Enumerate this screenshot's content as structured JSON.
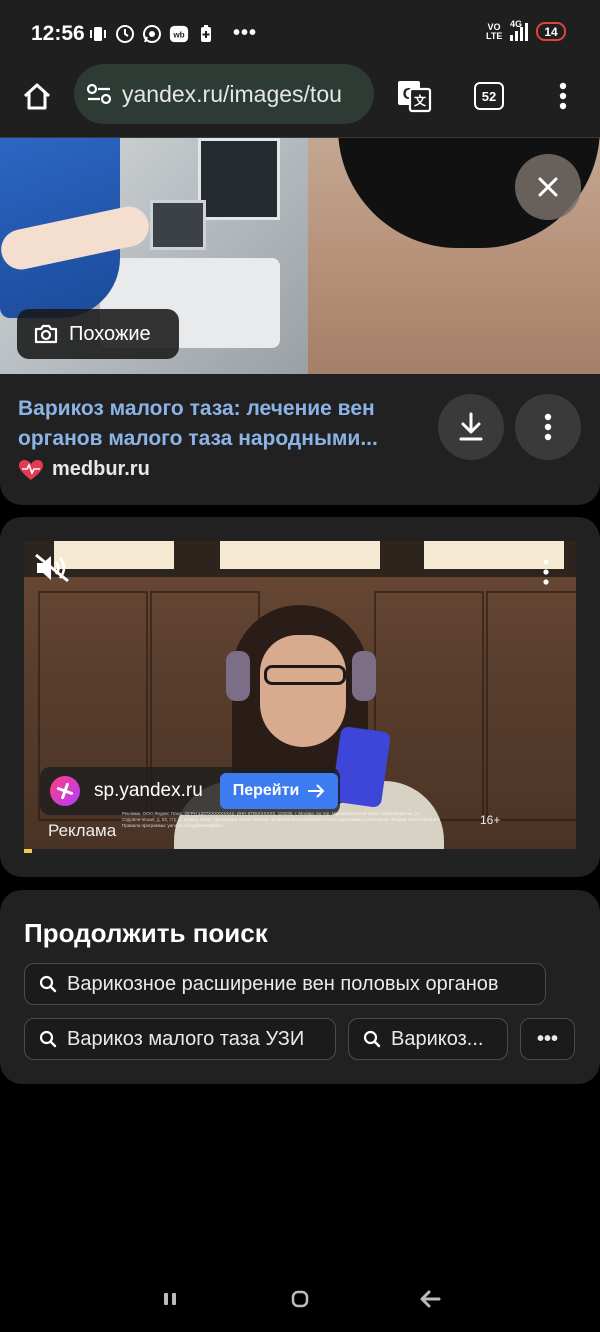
{
  "status_bar": {
    "time": "12:56",
    "network": "4G",
    "volte": "VO LTE",
    "battery": "14",
    "more": "•••"
  },
  "browser": {
    "url": "yandex.ru/images/tou",
    "tab_count": "52"
  },
  "result": {
    "similar_label": "Похожие",
    "title": "Варикоз малого таза: лечение вен органов малого таза народными...",
    "source": "medbur.ru"
  },
  "ad": {
    "domain": "sp.yandex.ru",
    "go_label": "Перейти",
    "label": "Реклама",
    "age": "16+",
    "fine_print": "Реклама. ООО Яндекс Плюс, ОГРН 1227XXXXXXX42, ИНН 9705XXXXX0, 115035, г. Москва, вн.тер. Муниципальный Округ Замоскворечье, ул Садовническая, д. 82, стр. 2, помещ. 6А04. Программа «Своя Плюса» является неотъемлемой частью программы лояльности «Яндекс Плюс Кешбэк». Правила программы: yandex.ru/legal/selectplusm",
    "progress": 0.015
  },
  "continue_search": {
    "title": "Продолжить поиск",
    "chips": [
      "Варикозное расширение вен половых органов",
      "Варикоз малого таза УЗИ",
      "Варикоз..."
    ],
    "more_label": "•••"
  },
  "colors": {
    "link": "#8cb3e6",
    "ad_button": "#3d7cf0",
    "url_bar": "#2d3b34",
    "battery_ring": "#e0443b"
  }
}
